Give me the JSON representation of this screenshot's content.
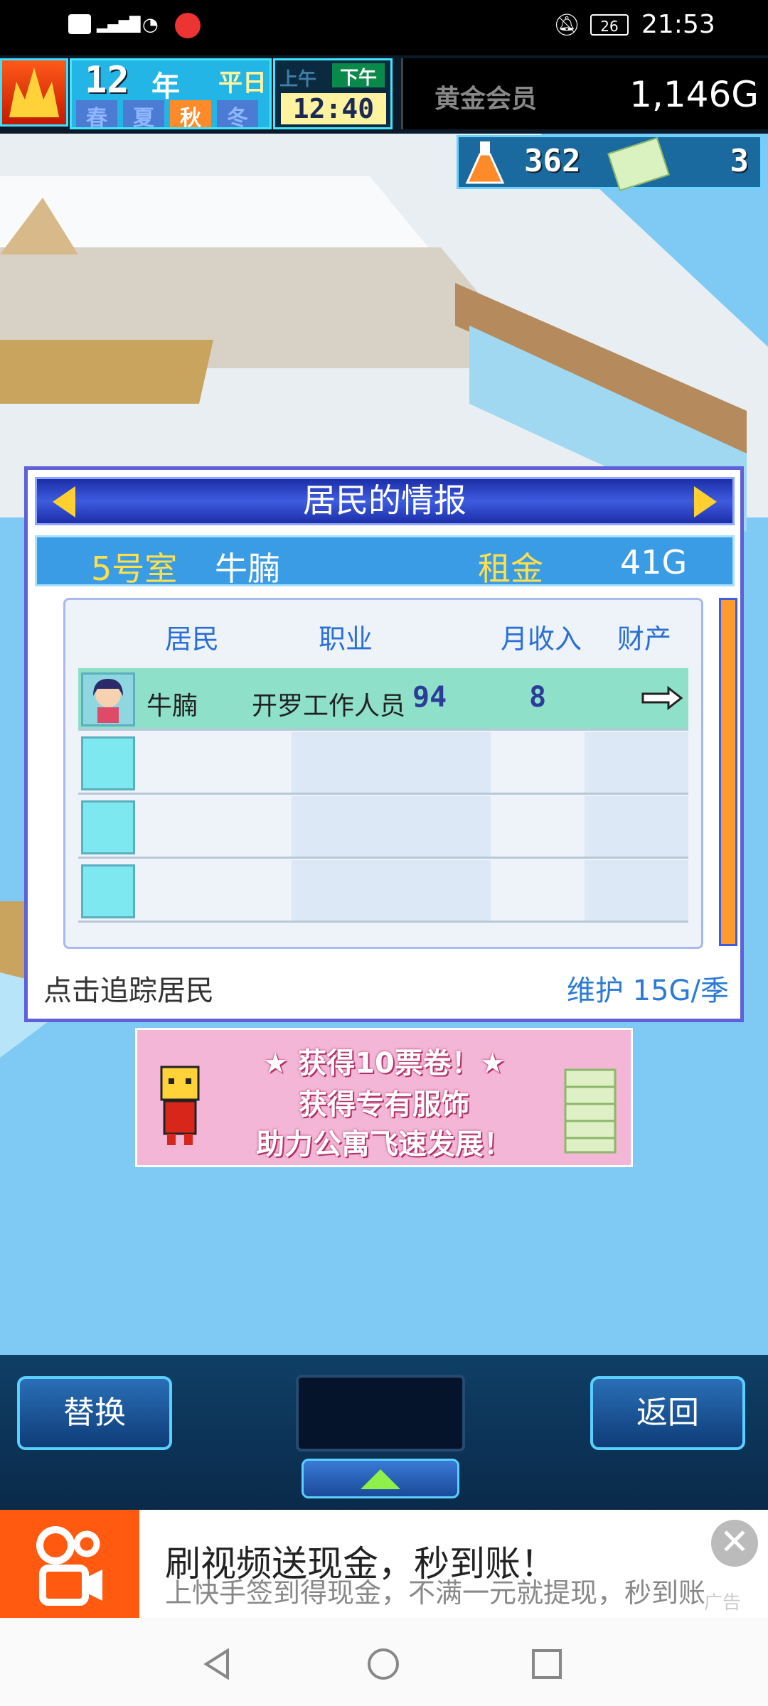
{
  "status_bar": {
    "left": "HD 4G",
    "time": "21:53",
    "battery": "26"
  },
  "hud": {
    "year_number": "12",
    "year_label": "年",
    "day_type": "平日",
    "seasons": [
      "春",
      "夏",
      "秋",
      "冬"
    ],
    "am": "上午",
    "pm": "下午",
    "clock": "12:40",
    "membership": "黄金会员",
    "money": "1,146G",
    "research_points": "362",
    "tickets": "3"
  },
  "dialog": {
    "title": "居民的情报",
    "room": "5号室",
    "resident_name": "牛腩",
    "rent_label": "租金",
    "rent_value": "41G",
    "headers": {
      "resident": "居民",
      "job": "职业",
      "income": "月收入",
      "assets": "财产"
    },
    "rows": [
      {
        "name": "牛腩",
        "job": "开罗工作人员",
        "income": "94",
        "assets": "8"
      }
    ],
    "footer_hint": "点击追踪居民",
    "maintenance": "维护 15G/季"
  },
  "banner": {
    "line1": "★ 获得10票卷！★",
    "line2": "获得专有服饰",
    "line3": "助力公寓飞速发展！"
  },
  "controls": {
    "swap": "替换",
    "back": "返回"
  },
  "ad": {
    "title": "刷视频送现金，秒到账！",
    "subtitle": "上快手签到得现金，不满一元就提现，秒到账",
    "tag": "广告"
  },
  "colors": {
    "dialog_border": "#6060d8",
    "accent_gold": "#ffd030",
    "accent_blue": "#2a7ad6",
    "scene_sky": "#7ecaf4"
  }
}
